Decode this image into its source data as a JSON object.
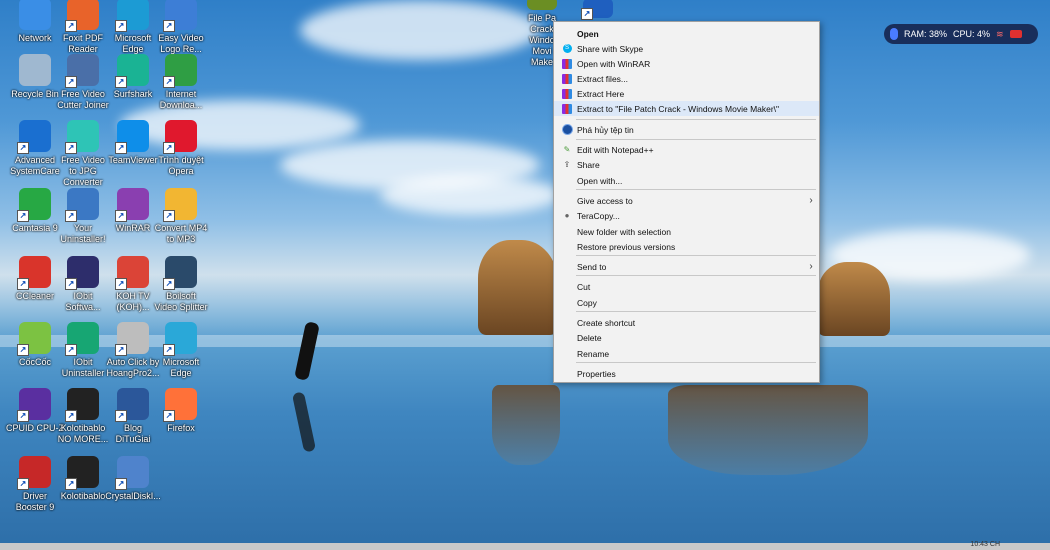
{
  "desktop_icons": [
    {
      "label": "Network",
      "icon": "network-icon",
      "color": "#3a8ee6"
    },
    {
      "label": "Foxit PDF\nReader",
      "icon": "foxit-pdf-icon",
      "color": "#e8632a"
    },
    {
      "label": "Microsoft\nEdge",
      "icon": "edge-icon",
      "color": "#1c9bd4"
    },
    {
      "label": "Easy Video\nLogo Re...",
      "icon": "easy-video-icon",
      "color": "#3d7ed6"
    },
    {
      "label": "Recycle Bin",
      "icon": "recycle-bin-icon",
      "color": "#9fb8d0"
    },
    {
      "label": "Free Video\nCutter Joiner",
      "icon": "video-cutter-icon",
      "color": "#4a6fa8"
    },
    {
      "label": "Surfshark",
      "icon": "surfshark-icon",
      "color": "#1ab394"
    },
    {
      "label": "Internet\nDownloa...",
      "icon": "idm-icon",
      "color": "#2f9e44"
    },
    {
      "label": "Advanced\nSystemCare",
      "icon": "advanced-systemcare-icon",
      "color": "#1a6fd0"
    },
    {
      "label": "Free Video\nto JPG Converter",
      "icon": "video-to-jpg-icon",
      "color": "#2ec4b6"
    },
    {
      "label": "TeamViewer",
      "icon": "teamviewer-icon",
      "color": "#0e8ee9"
    },
    {
      "label": "Trình duyệt\nOpera",
      "icon": "opera-icon",
      "color": "#e0182d"
    },
    {
      "label": "Camtasia 9",
      "icon": "camtasia-icon",
      "color": "#27a844"
    },
    {
      "label": "Your\nUninstaller!",
      "icon": "your-uninstaller-icon",
      "color": "#3b78c4"
    },
    {
      "label": "WinRAR",
      "icon": "winrar-icon",
      "color": "#8a3fb0"
    },
    {
      "label": "Convert MP4\nto MP3",
      "icon": "convert-mp4-icon",
      "color": "#f2b632"
    },
    {
      "label": "CCleaner",
      "icon": "ccleaner-icon",
      "color": "#d9342b"
    },
    {
      "label": "IObit\nSoftwa...",
      "icon": "iobit-software-icon",
      "color": "#2d2d6b"
    },
    {
      "label": "KOH TV\n(KOH)...",
      "icon": "chrome-app-icon",
      "color": "#db4437"
    },
    {
      "label": "Boilsoft\nVideo Splitter",
      "icon": "boilsoft-icon",
      "color": "#2a4a6a"
    },
    {
      "label": "CốcCốc",
      "icon": "coccoc-icon",
      "color": "#7cc242"
    },
    {
      "label": "IObit\nUninstaller",
      "icon": "iobit-uninstaller-icon",
      "color": "#17a673"
    },
    {
      "label": "Auto Click by\nHoangPro2...",
      "icon": "autoclick-icon",
      "color": "#bdbdbd"
    },
    {
      "label": "Microsoft\nEdge",
      "icon": "edge-icon-2",
      "color": "#2aa8d8"
    },
    {
      "label": "CPUID CPU-Z",
      "icon": "cpuz-icon",
      "color": "#5a2fa0"
    },
    {
      "label": "Kolotibablo\nNO MORE...",
      "icon": "kolotibablo-icon",
      "color": "#222222"
    },
    {
      "label": "Blog\nDiTuGiai",
      "icon": "word-doc-icon",
      "color": "#2b579a"
    },
    {
      "label": "Firefox",
      "icon": "firefox-icon",
      "color": "#ff7139"
    },
    {
      "label": "Driver\nBooster 9",
      "icon": "driver-booster-icon",
      "color": "#c62828"
    },
    {
      "label": "Kolotibablo",
      "icon": "kolotibablo-icon-2",
      "color": "#222222"
    },
    {
      "label": "CrystalDiskI...",
      "icon": "crystaldisk-icon",
      "color": "#4f83cc"
    }
  ],
  "top_icons": [
    {
      "label": "File Pa\nCrack\nWindo\nMovi\nMake",
      "icon": "winrar-archive-icon",
      "color": "#6b8e23"
    },
    {
      "label": "",
      "icon": "app-icon",
      "color": "#1f5fbf"
    }
  ],
  "monitor": {
    "ram": "RAM: 38%",
    "cpu": "CPU: 4%"
  },
  "context_menu": {
    "items": [
      {
        "label": "Open",
        "bold": true,
        "icon": ""
      },
      {
        "label": "Share with Skype",
        "icon": "skype-icon"
      },
      {
        "label": "Open with WinRAR",
        "icon": "winrar-icon"
      },
      {
        "label": "Extract files...",
        "icon": "winrar-icon"
      },
      {
        "label": "Extract Here",
        "icon": "winrar-icon"
      },
      {
        "label": "Extract to \"File Patch Crack - Windows Movie Maker\\\"",
        "icon": "winrar-icon",
        "hover": true
      },
      {
        "label": "Phá hủy tệp tin",
        "icon": "shield-icon"
      },
      {
        "label": "Edit with Notepad++",
        "icon": "notepadpp-icon"
      },
      {
        "label": "Share",
        "icon": "share-icon"
      },
      {
        "label": "Open with...",
        "icon": ""
      },
      {
        "label": "Give access to",
        "icon": "",
        "submenu": true
      },
      {
        "label": "TeraCopy...",
        "icon": "teracopy-icon"
      },
      {
        "label": "New folder with selection",
        "icon": ""
      },
      {
        "label": "Restore previous versions",
        "icon": ""
      },
      {
        "label": "Send to",
        "icon": "",
        "submenu": true
      },
      {
        "label": "Cut",
        "icon": ""
      },
      {
        "label": "Copy",
        "icon": ""
      },
      {
        "label": "Create shortcut",
        "icon": ""
      },
      {
        "label": "Delete",
        "icon": ""
      },
      {
        "label": "Rename",
        "icon": ""
      },
      {
        "label": "Properties",
        "icon": ""
      }
    ],
    "submenu_arrow": "›"
  },
  "taskbar": {
    "clock": "10:43 CH"
  }
}
